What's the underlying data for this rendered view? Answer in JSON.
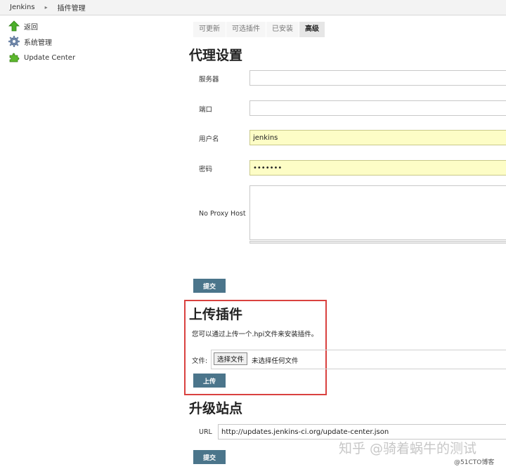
{
  "breadcrumb": {
    "root": "Jenkins",
    "current": "插件管理"
  },
  "sidebar": {
    "items": [
      {
        "label": "返回",
        "icon": "up-arrow-icon"
      },
      {
        "label": "系统管理",
        "icon": "gear-icon"
      },
      {
        "label": "Update Center",
        "icon": "puzzle-icon"
      }
    ]
  },
  "tabs": [
    {
      "label": "可更新",
      "active": false
    },
    {
      "label": "可选插件",
      "active": false
    },
    {
      "label": "已安装",
      "active": false
    },
    {
      "label": "高级",
      "active": true
    }
  ],
  "proxy": {
    "title": "代理设置",
    "server_label": "服务器",
    "server_value": "",
    "port_label": "端口",
    "port_value": "",
    "user_label": "用户名",
    "user_value": "jenkins",
    "password_label": "密码",
    "password_value": "•••••••",
    "noproxy_label": "No Proxy Host",
    "submit_label": "提交"
  },
  "upload": {
    "title": "上传插件",
    "description": "您可以通过上传一个.hpi文件来安装插件。",
    "file_label": "文件:",
    "choose_label": "选择文件",
    "no_file_text": "未选择任何文件",
    "submit_label": "上传"
  },
  "update_site": {
    "title": "升级站点",
    "url_label": "URL",
    "url_value": "http://updates.jenkins-ci.org/update-center.json",
    "submit_label": "提交"
  },
  "watermark": {
    "main": "知乎 @骑着蜗牛的测试",
    "sub": "@51CTO博客"
  },
  "colors": {
    "button": "#4b758b",
    "highlight_input": "#fdfdc6",
    "annotation_box": "#d9413f"
  }
}
